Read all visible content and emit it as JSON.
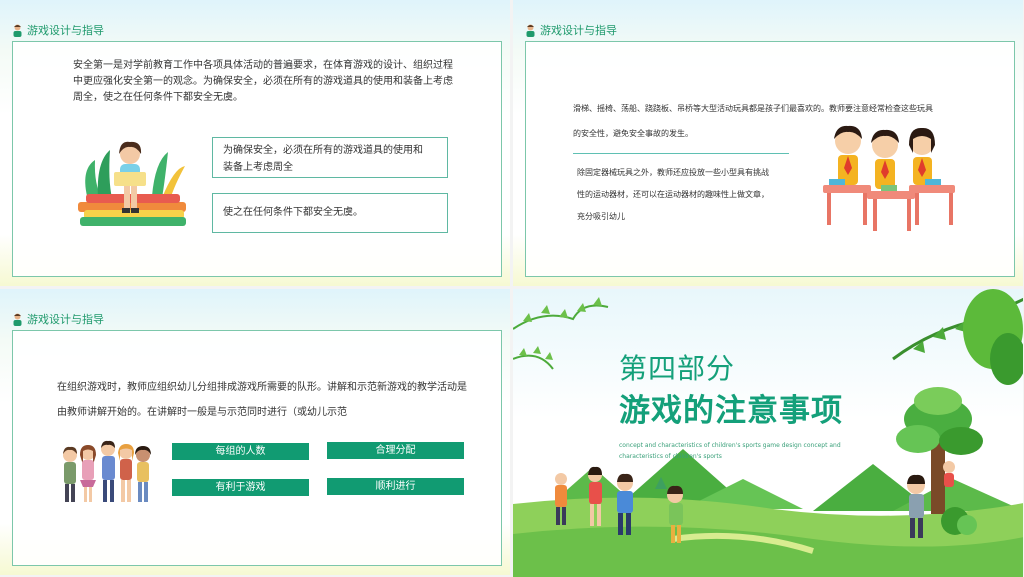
{
  "section_label": "游戏设计与指导",
  "slide1": {
    "paragraph_lines": [
      "安全第一是对学前教育工作中各项具体活动的普遍要求，在体育游戏的设计、组织过程",
      "中更应强化安全第一的观念。为确保安全，必须在所有的游戏道具的使用和装备上考虑",
      "周全，使之在任何条件下都安全无虞。"
    ],
    "box1_lines": [
      "为确保安全，必须在所有的游戏道具的使用和",
      "装备上考虑周全"
    ],
    "box2": "使之在任何条件下都安全无虞。"
  },
  "slide2": {
    "paragraph_lines": [
      "滑梯、摇椅、荡船、跷跷板、吊桥等大型活动玩具都是孩子们最喜欢的。教师要注意经常检查这些玩具",
      "的安全性，避免安全事故的发生。"
    ],
    "sub_lines": [
      "除固定器械玩具之外，教师还应投放一些小型具有挑战",
      "性的运动器材，还可以在运动器材的趣味性上做文章，",
      "充分吸引幼儿"
    ]
  },
  "slide3": {
    "paragraph_lines": [
      "在组织游戏时，教师应组织幼儿分组排成游戏所需要的队形。讲解和示范新游戏的教学活动是",
      "由教师讲解开始的。在讲解时一般是与示范同时进行（或幼儿示范"
    ],
    "pills": [
      "每组的人数",
      "合理分配",
      "有利于游戏",
      "顺利进行"
    ]
  },
  "slide4": {
    "part": "第四部分",
    "title": "游戏的注意事项",
    "subtitle_lines": [
      "concept and characteristics of children's sports game design concept and",
      "characteristics of children's sports"
    ]
  },
  "colors": {
    "accent_green": "#119b72",
    "border_green": "#7cc7aa",
    "title_green": "#14a07a"
  }
}
